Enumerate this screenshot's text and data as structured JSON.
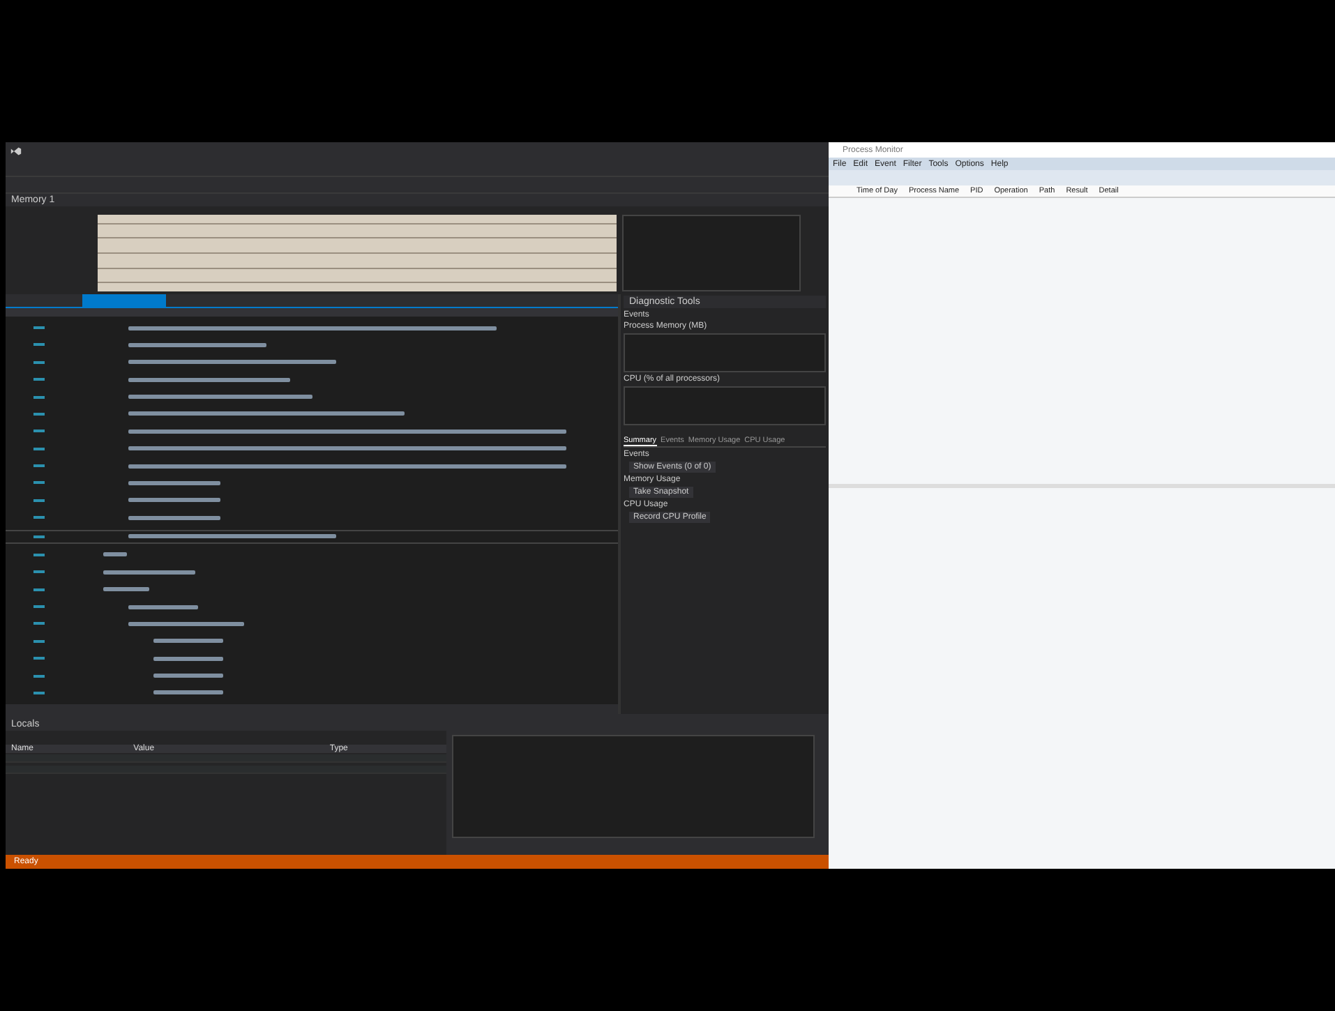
{
  "vs": {
    "memory": {
      "title": "Memory 1"
    },
    "diagnostics": {
      "title": "Diagnostic Tools",
      "events_label": "Events",
      "memory_chart_label": "Process Memory (MB)",
      "cpu_chart_label": "CPU (% of all processors)",
      "tabs": [
        {
          "label": "Summary",
          "selected": true
        },
        {
          "label": "Events",
          "selected": false
        },
        {
          "label": "Memory Usage",
          "selected": false
        },
        {
          "label": "CPU Usage",
          "selected": false
        }
      ],
      "sections": [
        {
          "heading": "Events",
          "action": "Show Events (0 of 0)"
        },
        {
          "heading": "Memory Usage",
          "action": "Take Snapshot"
        },
        {
          "heading": "CPU Usage",
          "action": "Record CPU Profile"
        }
      ]
    },
    "locals": {
      "title": "Locals",
      "columns": [
        "Name",
        "Value",
        "Type"
      ]
    },
    "status_bar": "Ready"
  },
  "procmon": {
    "title": "Process Monitor",
    "menu": [
      "File",
      "Edit",
      "Event",
      "Filter",
      "Tools",
      "Options",
      "Help"
    ],
    "columns": [
      "Time of Day",
      "Process Name",
      "PID",
      "Operation",
      "Path",
      "Result",
      "Detail"
    ]
  }
}
